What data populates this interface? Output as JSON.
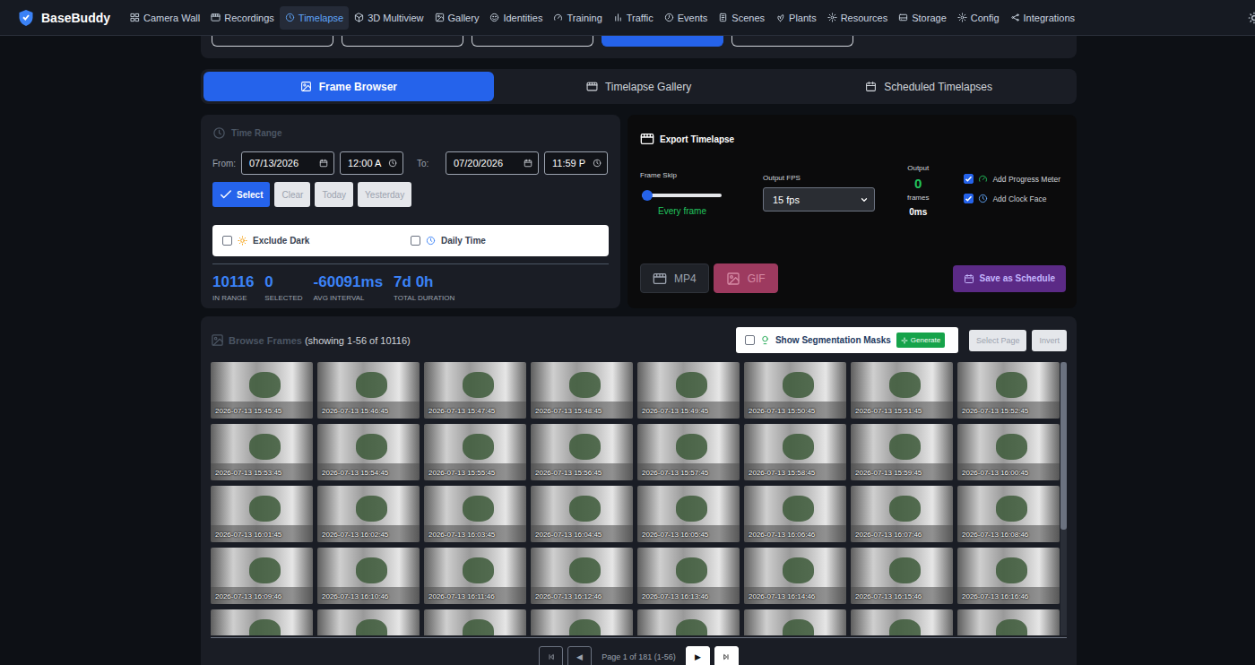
{
  "app": {
    "name": "BaseBuddy"
  },
  "nav": [
    {
      "label": "Camera Wall",
      "selected": false
    },
    {
      "label": "Recordings",
      "selected": false
    },
    {
      "label": "Timelapse",
      "selected": true
    },
    {
      "label": "3D Multiview",
      "selected": false
    },
    {
      "label": "Gallery",
      "selected": false
    },
    {
      "label": "Identities",
      "selected": false
    },
    {
      "label": "Training",
      "selected": false
    },
    {
      "label": "Traffic",
      "selected": false
    },
    {
      "label": "Events",
      "selected": false
    },
    {
      "label": "Scenes",
      "selected": false
    },
    {
      "label": "Plants",
      "selected": false
    },
    {
      "label": "Resources",
      "selected": false
    },
    {
      "label": "Storage",
      "selected": false
    },
    {
      "label": "Config",
      "selected": false
    },
    {
      "label": "Integrations",
      "selected": false
    }
  ],
  "presets": [
    {
      "selected": false
    },
    {
      "selected": false
    },
    {
      "selected": false
    },
    {
      "selected": true
    },
    {
      "selected": false
    }
  ],
  "subtabs": [
    {
      "label": "Frame Browser",
      "selected": true
    },
    {
      "label": "Timelapse Gallery",
      "selected": false
    },
    {
      "label": "Scheduled Timelapses",
      "selected": false
    }
  ],
  "time_range": {
    "title": "Time Range",
    "from_label": "From:",
    "from_date": "07/13/2026",
    "from_time": "12:00 A",
    "to_label": "To:",
    "to_date": "07/20/2026",
    "to_time": "11:59 P",
    "buttons": [
      {
        "label": "Select",
        "primary": true
      },
      {
        "label": "Clear",
        "primary": false
      },
      {
        "label": "Today",
        "primary": false
      },
      {
        "label": "Yesterday",
        "primary": false
      }
    ],
    "filters": [
      {
        "label": "Exclude Dark",
        "checked": false
      },
      {
        "label": "Daily Time",
        "checked": false
      }
    ],
    "stats": [
      {
        "value": "10116",
        "label": "IN RANGE"
      },
      {
        "value": "0",
        "label": "SELECTED"
      },
      {
        "value": "-60091ms",
        "label": "AVG INTERVAL"
      },
      {
        "value": "7d 0h",
        "label": "TOTAL DURATION"
      }
    ]
  },
  "export": {
    "title": "Export Timelapse",
    "frame_skip": {
      "label": "Frame Skip",
      "level": 0,
      "reading": "Every frame"
    },
    "fps": {
      "label": "Output FPS",
      "value": "15 fps"
    },
    "output": {
      "label": "Output",
      "frames": "0",
      "frames_label": "frames",
      "duration": "0ms"
    },
    "options": [
      {
        "label": "Add Progress Meter",
        "checked": true
      },
      {
        "label": "Add Clock Face",
        "checked": true
      }
    ],
    "formats": [
      {
        "label": "MP4",
        "selected": false
      },
      {
        "label": "GIF",
        "selected": true
      }
    ],
    "schedule_button": "Save as Schedule"
  },
  "browse": {
    "title": "Browse Frames",
    "count": "(showing 1-56 of 10116)",
    "masks": {
      "label": "Show Segmentation Masks",
      "checked": false,
      "generate": "Generate"
    },
    "buttons": [
      "Select Page",
      "Invert"
    ],
    "frames": [
      {
        "time": "2026-07-13 15:45:45",
        "label_visible": true
      },
      {
        "time": "2026-07-13 15:46:45",
        "label_visible": true
      },
      {
        "time": "2026-07-13 15:47:45",
        "label_visible": true
      },
      {
        "time": "2026-07-13 15:48:45",
        "label_visible": true
      },
      {
        "time": "2026-07-13 15:49:45",
        "label_visible": true
      },
      {
        "time": "2026-07-13 15:50:45",
        "label_visible": true
      },
      {
        "time": "2026-07-13 15:51:45",
        "label_visible": true
      },
      {
        "time": "2026-07-13 15:52:45",
        "label_visible": true
      },
      {
        "time": "2026-07-13 15:53:45",
        "label_visible": true
      },
      {
        "time": "2026-07-13 15:54:45",
        "label_visible": true
      },
      {
        "time": "2026-07-13 15:55:45",
        "label_visible": true
      },
      {
        "time": "2026-07-13 15:56:45",
        "label_visible": true
      },
      {
        "time": "2026-07-13 15:57:45",
        "label_visible": true
      },
      {
        "time": "2026-07-13 15:58:45",
        "label_visible": true
      },
      {
        "time": "2026-07-13 15:59:45",
        "label_visible": true
      },
      {
        "time": "2026-07-13 16:00:45",
        "label_visible": true
      },
      {
        "time": "2026-07-13 16:01:45",
        "label_visible": true
      },
      {
        "time": "2026-07-13 16:02:45",
        "label_visible": true
      },
      {
        "time": "2026-07-13 16:03:45",
        "label_visible": true
      },
      {
        "time": "2026-07-13 16:04:45",
        "label_visible": true
      },
      {
        "time": "2026-07-13 16:05:45",
        "label_visible": true
      },
      {
        "time": "2026-07-13 16:06:46",
        "label_visible": true
      },
      {
        "time": "2026-07-13 16:07:46",
        "label_visible": true
      },
      {
        "time": "2026-07-13 16:08:46",
        "label_visible": true
      },
      {
        "time": "2026-07-13 16:09:46",
        "label_visible": true
      },
      {
        "time": "2026-07-13 16:10:46",
        "label_visible": true
      },
      {
        "time": "2026-07-13 16:11:46",
        "label_visible": true
      },
      {
        "time": "2026-07-13 16:12:46",
        "label_visible": true
      },
      {
        "time": "2026-07-13 16:13:46",
        "label_visible": true
      },
      {
        "time": "2026-07-13 16:14:46",
        "label_visible": true
      },
      {
        "time": "2026-07-13 16:15:46",
        "label_visible": true
      },
      {
        "time": "2026-07-13 16:16:46",
        "label_visible": true
      },
      {
        "label_visible": false
      },
      {
        "label_visible": false
      },
      {
        "label_visible": false
      },
      {
        "label_visible": false
      },
      {
        "label_visible": false
      },
      {
        "label_visible": false
      },
      {
        "label_visible": false
      },
      {
        "label_visible": false
      }
    ]
  },
  "pagination": {
    "buttons": [
      {
        "kind": "first",
        "disabled": true
      },
      {
        "kind": "prev",
        "label": "◀",
        "disabled": true
      },
      {
        "kind": "next",
        "label": "▶",
        "disabled": false
      },
      {
        "kind": "last",
        "disabled": false
      }
    ],
    "text": "Page 1 of 181 (1-56)"
  }
}
